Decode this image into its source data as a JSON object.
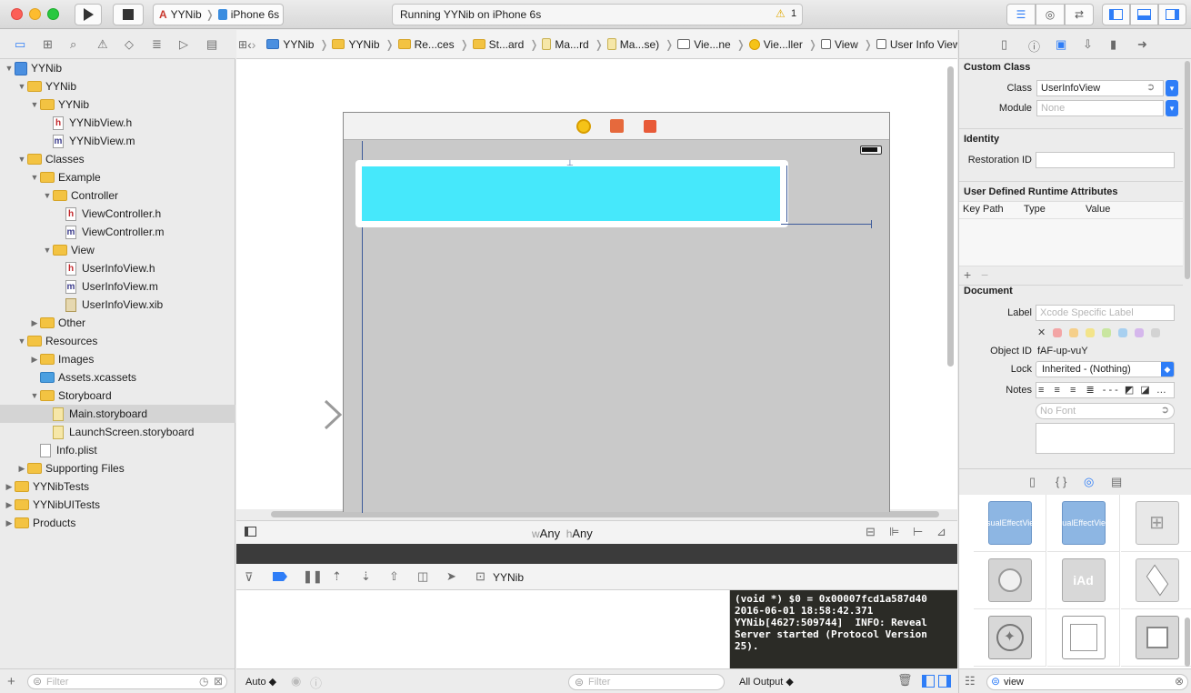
{
  "toolbar": {
    "scheme_project": "YYNib",
    "scheme_device": "iPhone 6s",
    "activity_status": "Running YYNib on iPhone 6s",
    "warning_count": "1"
  },
  "navigator": {
    "rows": [
      {
        "label": "YYNib",
        "level": 0,
        "kind": "proj",
        "open": true
      },
      {
        "label": "YYNib",
        "level": 1,
        "kind": "folder",
        "open": true
      },
      {
        "label": "YYNib",
        "level": 2,
        "kind": "folder",
        "open": true
      },
      {
        "label": "YYNibView.h",
        "level": 3,
        "kind": "h"
      },
      {
        "label": "YYNibView.m",
        "level": 3,
        "kind": "m"
      },
      {
        "label": "Classes",
        "level": 1,
        "kind": "folder",
        "open": true
      },
      {
        "label": "Example",
        "level": 2,
        "kind": "folder",
        "open": true
      },
      {
        "label": "Controller",
        "level": 3,
        "kind": "folder",
        "open": true
      },
      {
        "label": "ViewController.h",
        "level": 4,
        "kind": "h"
      },
      {
        "label": "ViewController.m",
        "level": 4,
        "kind": "m"
      },
      {
        "label": "View",
        "level": 3,
        "kind": "folder",
        "open": true
      },
      {
        "label": "UserInfoView.h",
        "level": 4,
        "kind": "h"
      },
      {
        "label": "UserInfoView.m",
        "level": 4,
        "kind": "m"
      },
      {
        "label": "UserInfoView.xib",
        "level": 4,
        "kind": "xib"
      },
      {
        "label": "Other",
        "level": 2,
        "kind": "folder",
        "open": false
      },
      {
        "label": "Resources",
        "level": 1,
        "kind": "folder",
        "open": true
      },
      {
        "label": "Images",
        "level": 2,
        "kind": "folder",
        "open": false
      },
      {
        "label": "Assets.xcassets",
        "level": 2,
        "kind": "blue"
      },
      {
        "label": "Storyboard",
        "level": 2,
        "kind": "folder",
        "open": true
      },
      {
        "label": "Main.storyboard",
        "level": 3,
        "kind": "sb",
        "selected": true
      },
      {
        "label": "LaunchScreen.storyboard",
        "level": 3,
        "kind": "sb"
      },
      {
        "label": "Info.plist",
        "level": 2,
        "kind": "plist"
      },
      {
        "label": "Supporting Files",
        "level": 1,
        "kind": "folder",
        "open": false
      },
      {
        "label": "YYNibTests",
        "level": 0,
        "kind": "folder",
        "open": false
      },
      {
        "label": "YYNibUITests",
        "level": 0,
        "kind": "folder",
        "open": false
      },
      {
        "label": "Products",
        "level": 0,
        "kind": "folder",
        "open": false
      }
    ],
    "filter_placeholder": "Filter"
  },
  "jumpbar": {
    "crumbs": [
      "YYNib",
      "YYNib",
      "Re...ces",
      "St...ard",
      "Ma...rd",
      "Ma...se)",
      "Vie...ne",
      "Vie...ller",
      "View",
      "User Info View"
    ]
  },
  "canvas": {
    "size_w_prefix": "w",
    "size_w": "Any",
    "size_h_prefix": "h",
    "size_h": "Any"
  },
  "debug": {
    "process_name": "YYNib",
    "console_text": "(void *) $0 = 0x00007fcd1a587d40\n2016-06-01 18:58:42.371\nYYNib[4627:509744]  INFO: Reveal\nServer started (Protocol Version\n25).",
    "auto_label": "Auto ◆",
    "filter_placeholder": "Filter",
    "output_label": "All Output ◆"
  },
  "inspector": {
    "custom_class_title": "Custom Class",
    "class_label": "Class",
    "class_value": "UserInfoView",
    "module_label": "Module",
    "module_placeholder": "None",
    "identity_title": "Identity",
    "restoration_label": "Restoration ID",
    "runtime_title": "User Defined Runtime Attributes",
    "col_keypath": "Key Path",
    "col_type": "Type",
    "col_value": "Value",
    "document_title": "Document",
    "label_label": "Label",
    "label_placeholder": "Xcode Specific Label",
    "objectid_label": "Object ID",
    "objectid_value": "fAF-up-vuY",
    "lock_label": "Lock",
    "lock_value": "Inherited - (Nothing)",
    "notes_label": "Notes",
    "font_placeholder": "No Font"
  },
  "library": {
    "items": [
      {
        "name": "Visual Effect View",
        "lines": [
          "Visual",
          "Effect",
          "View"
        ]
      },
      {
        "name": "Visual Effect Views",
        "lines": [
          "Visual",
          "Effect",
          "Views"
        ]
      },
      {
        "name": "Map"
      },
      {
        "name": "GLKit View"
      },
      {
        "name": "iAd",
        "lines": [
          "iAd"
        ]
      },
      {
        "name": "SceneKit"
      },
      {
        "name": "Web View"
      },
      {
        "name": "View"
      },
      {
        "name": "Container View"
      }
    ],
    "search_value": "view"
  },
  "colors": {
    "cyan_view": "#46e8fb",
    "folder": "#f3c342",
    "accent": "#2e7df7",
    "console_bg": "#2b2b26"
  }
}
